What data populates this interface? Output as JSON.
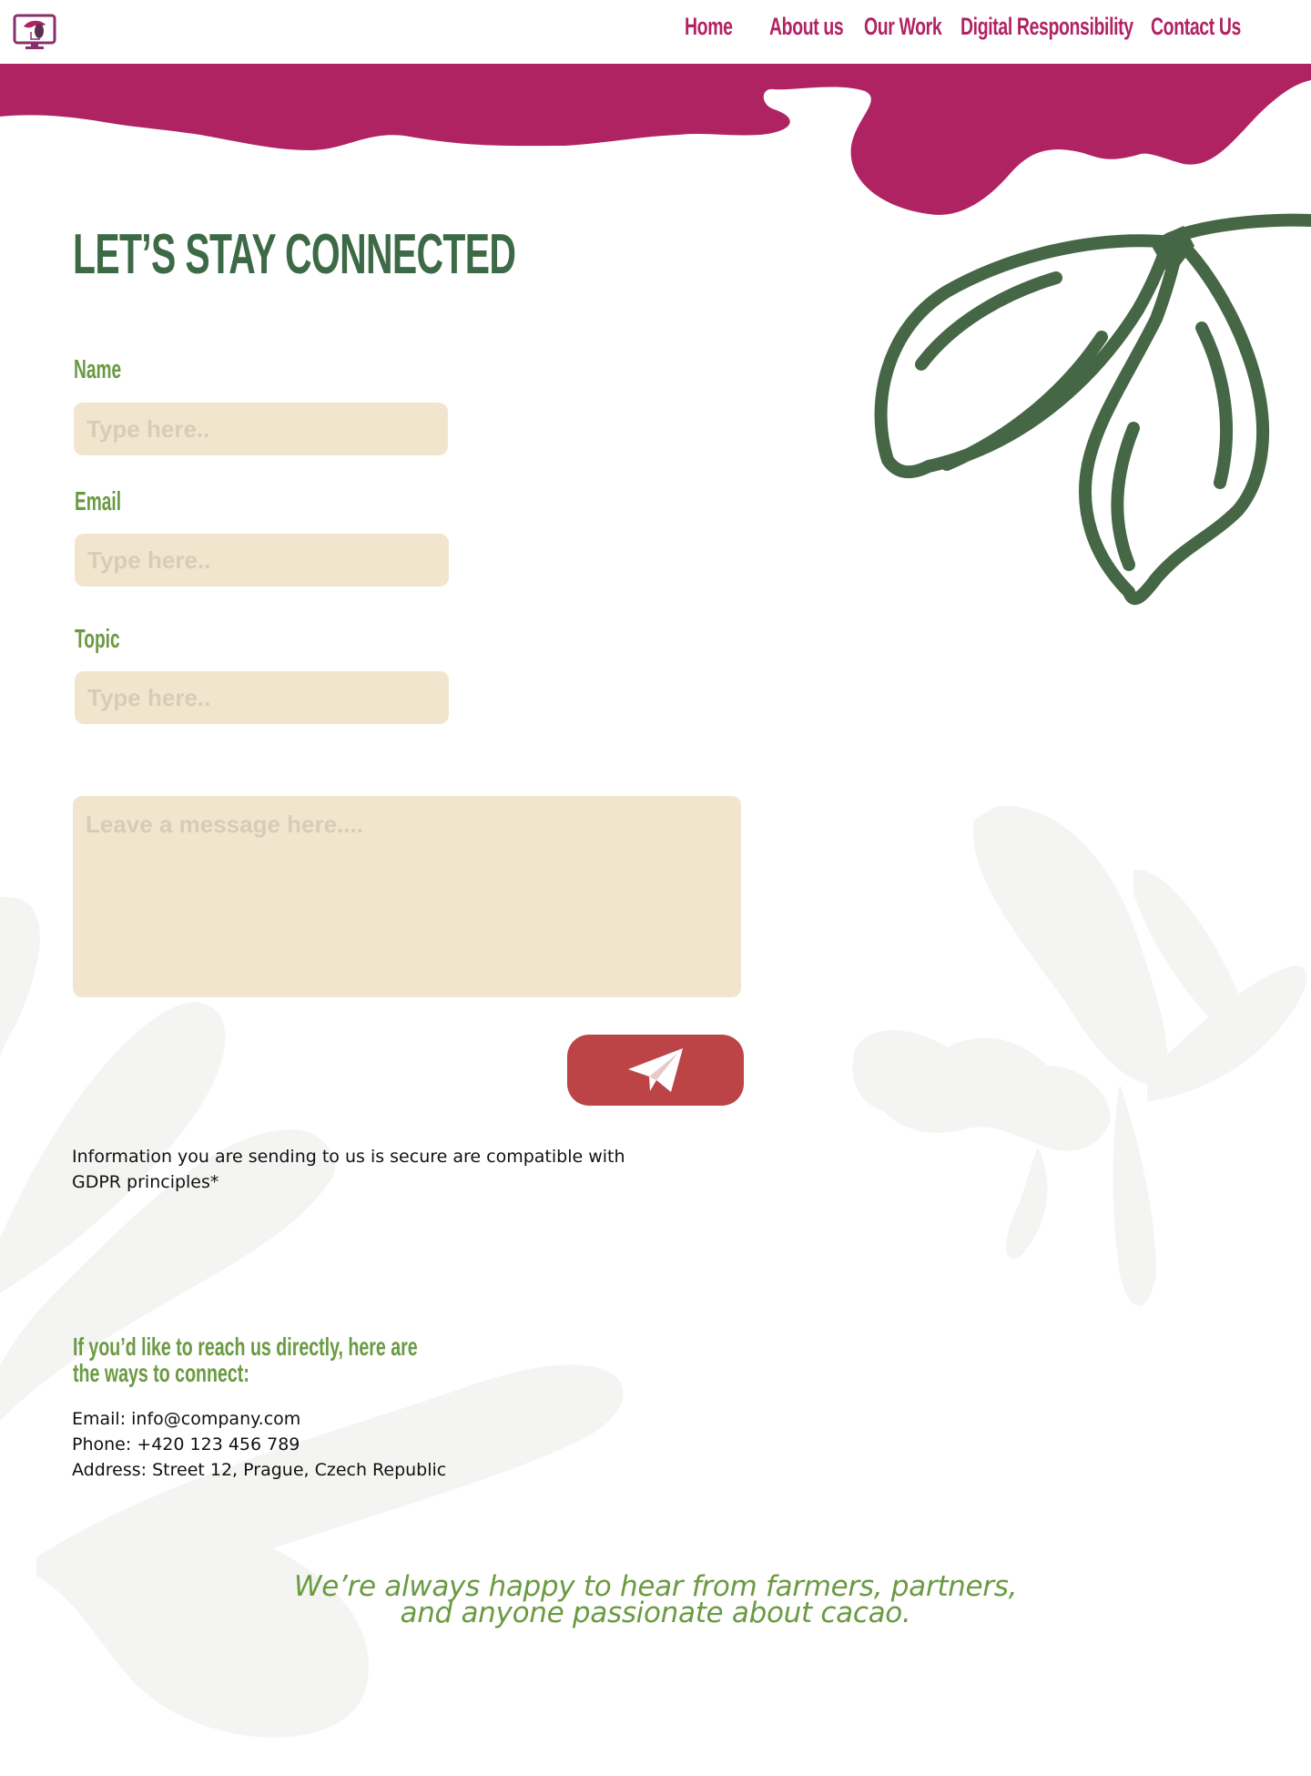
{
  "nav": {
    "items": [
      {
        "label": "Home"
      },
      {
        "label": "About us"
      },
      {
        "label": "Our Work"
      },
      {
        "label": "Digital Responsibility"
      },
      {
        "label": "Contact Us"
      }
    ]
  },
  "colors": {
    "brand_magenta": "#b02362",
    "title_green": "#3d6a46",
    "label_green": "#6a9a42",
    "input_beige": "#f1e6cd",
    "send_red": "#bd4446"
  },
  "contact_form": {
    "title": "LET’S STAY CONNECTED",
    "fields": {
      "name": {
        "label": "Name",
        "placeholder": "Type here.."
      },
      "email": {
        "label": "Email",
        "placeholder": "Type here.."
      },
      "topic": {
        "label": "Topic",
        "placeholder": "Type here.."
      }
    },
    "message_placeholder": "Leave a message here....",
    "send_icon": "paper-plane-icon",
    "gdpr_note": "Information you are sending to us is secure are compatible with GDPR principles*"
  },
  "direct_contact": {
    "heading": "If you’d like to reach us directly, here are the ways to connect:",
    "email_line": "Email: info@company.com",
    "phone_line": "Phone: +420 123 456 789",
    "address_line": "Address: Street 12, Prague, Czech Republic"
  },
  "closing": {
    "line1": "We’re always happy to hear from farmers, partners,",
    "line2": "and anyone passionate about cacao."
  }
}
